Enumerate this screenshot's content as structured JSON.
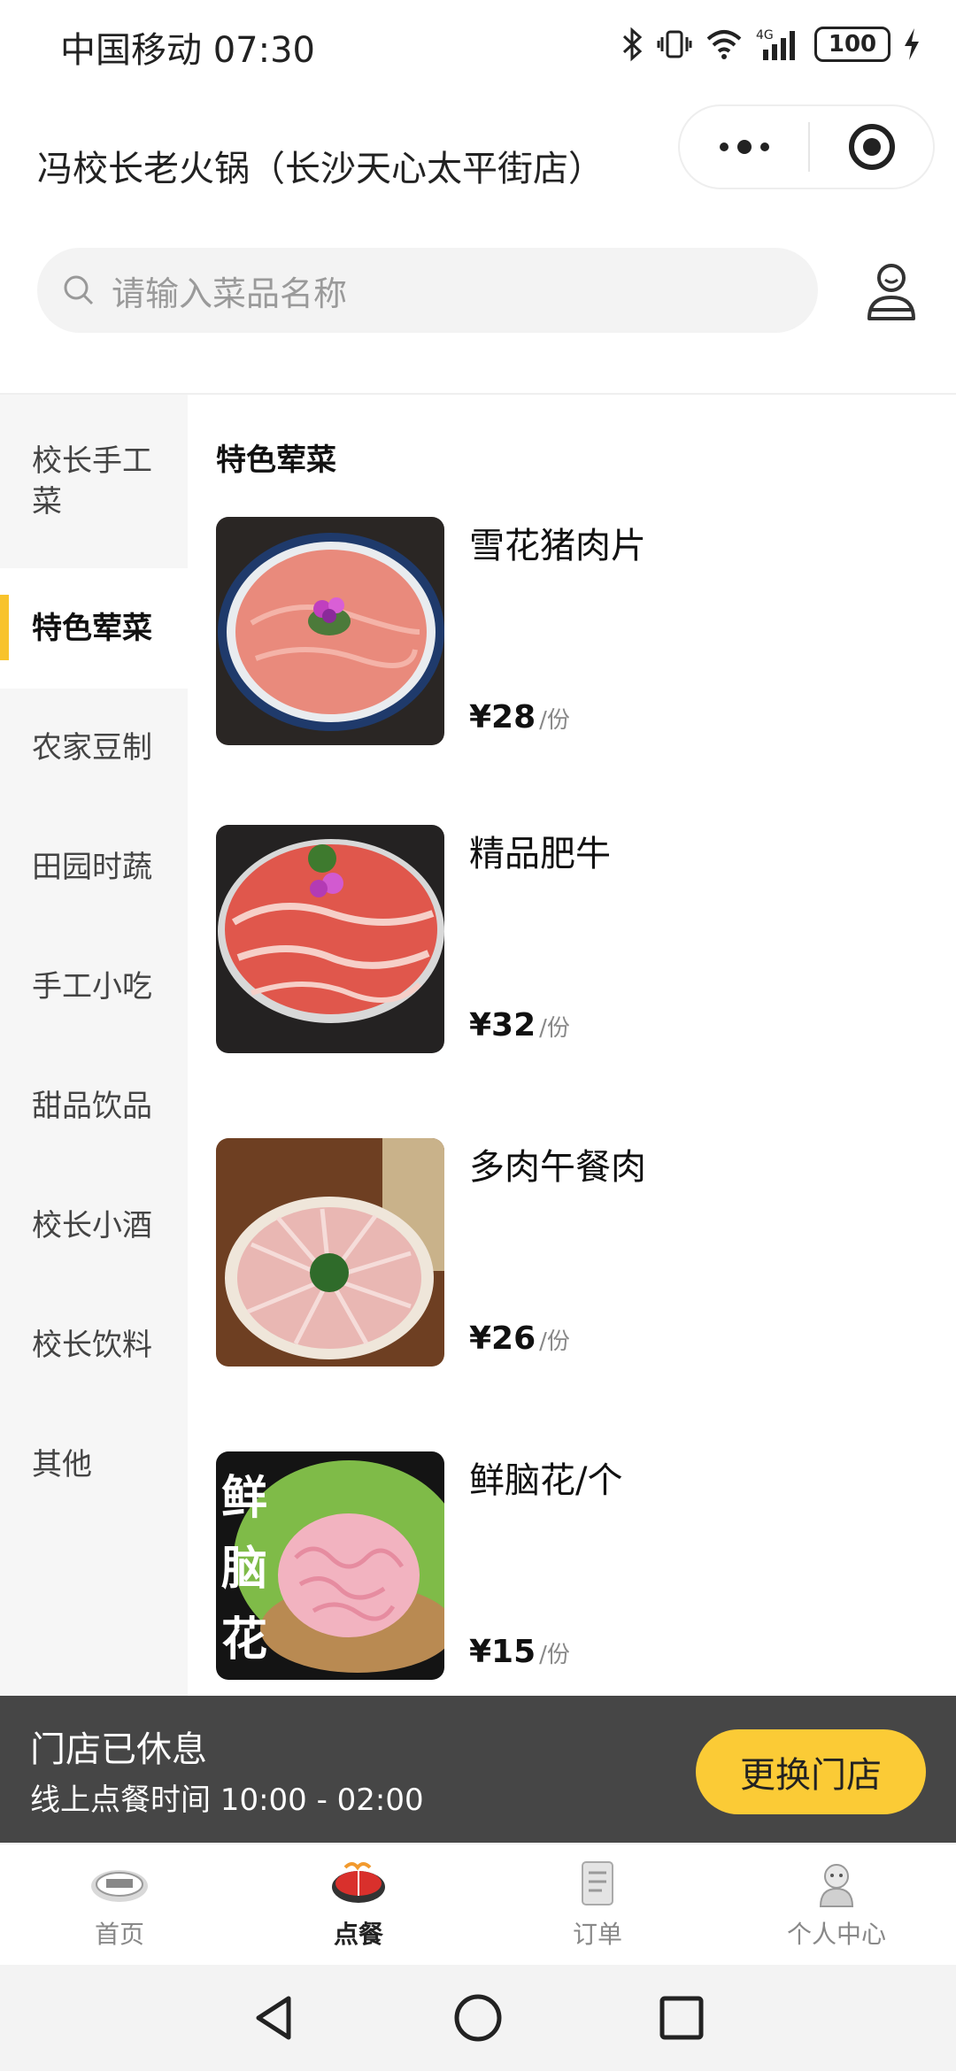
{
  "status_bar": {
    "carrier_time": "中国移动 07:30",
    "battery": "100",
    "network": "4G"
  },
  "header": {
    "store_name": "冯校长老火锅（长沙天心太平街店）"
  },
  "search": {
    "placeholder": "请输入菜品名称"
  },
  "sidebar": {
    "categories": [
      {
        "label": "校长手工菜",
        "active": false
      },
      {
        "label": "特色荤菜",
        "active": true
      },
      {
        "label": "农家豆制",
        "active": false
      },
      {
        "label": "田园时蔬",
        "active": false
      },
      {
        "label": "手工小吃",
        "active": false
      },
      {
        "label": "甜品饮品",
        "active": false
      },
      {
        "label": "校长小酒",
        "active": false
      },
      {
        "label": "校长饮料",
        "active": false
      },
      {
        "label": "其他",
        "active": false
      }
    ]
  },
  "menu": {
    "section_title": "特色荤菜",
    "dishes": [
      {
        "name": "雪花猪肉片",
        "price": "¥28",
        "unit": "/份"
      },
      {
        "name": "精品肥牛",
        "price": "¥32",
        "unit": "/份"
      },
      {
        "name": "多肉午餐肉",
        "price": "¥26",
        "unit": "/份"
      },
      {
        "name": "鲜脑花/个",
        "price": "¥15",
        "unit": "/份",
        "image_text": "鲜脑花"
      }
    ]
  },
  "closed_notice": {
    "title": "门店已休息",
    "hours": "线上点餐时间 10:00 - 02:00",
    "button": "更换门店"
  },
  "tabbar": {
    "items": [
      {
        "label": "首页",
        "active": false
      },
      {
        "label": "点餐",
        "active": true
      },
      {
        "label": "订单",
        "active": false
      },
      {
        "label": "个人中心",
        "active": false
      }
    ]
  },
  "colors": {
    "accent": "#fbcb36",
    "sidebar_indicator": "#f8c32c",
    "closed_bar": "#464646"
  }
}
